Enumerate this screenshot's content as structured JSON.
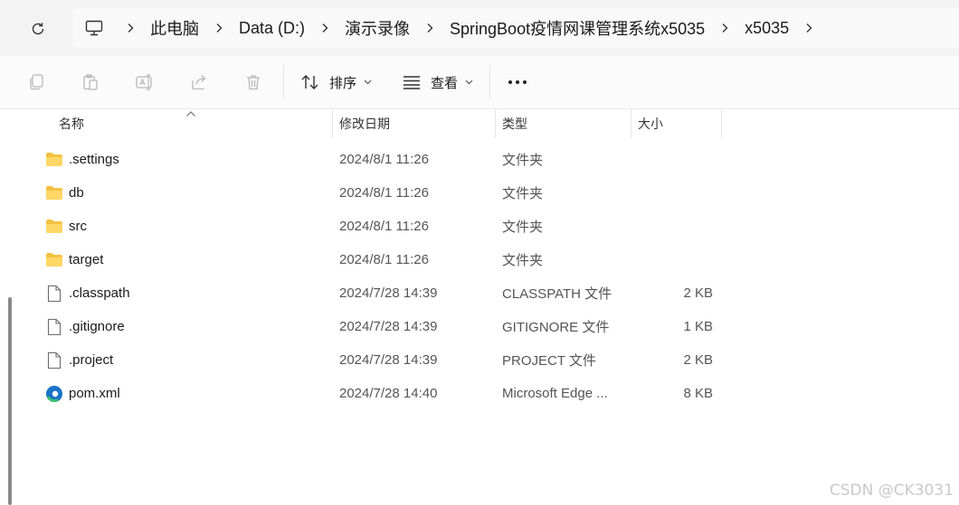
{
  "address": {
    "crumbs": [
      "此电脑",
      "Data (D:)",
      "演示录像",
      "SpringBoot疫情网课管理系统x5035",
      "x5035"
    ]
  },
  "toolbar": {
    "sort_label": "排序",
    "view_label": "查看"
  },
  "columns": {
    "name": "名称",
    "modified": "修改日期",
    "type": "类型",
    "size": "大小"
  },
  "files": [
    {
      "name": ".settings",
      "modified": "2024/8/1 11:26",
      "type": "文件夹",
      "size": "",
      "icon": "folder-icon"
    },
    {
      "name": "db",
      "modified": "2024/8/1 11:26",
      "type": "文件夹",
      "size": "",
      "icon": "folder-icon"
    },
    {
      "name": "src",
      "modified": "2024/8/1 11:26",
      "type": "文件夹",
      "size": "",
      "icon": "folder-icon"
    },
    {
      "name": "target",
      "modified": "2024/8/1 11:26",
      "type": "文件夹",
      "size": "",
      "icon": "folder-icon"
    },
    {
      "name": ".classpath",
      "modified": "2024/7/28 14:39",
      "type": "CLASSPATH 文件",
      "size": "2 KB",
      "icon": "file-icon"
    },
    {
      "name": ".gitignore",
      "modified": "2024/7/28 14:39",
      "type": "GITIGNORE 文件",
      "size": "1 KB",
      "icon": "file-icon"
    },
    {
      "name": ".project",
      "modified": "2024/7/28 14:39",
      "type": "PROJECT 文件",
      "size": "2 KB",
      "icon": "file-icon"
    },
    {
      "name": "pom.xml",
      "modified": "2024/7/28 14:40",
      "type": "Microsoft Edge ...",
      "size": "8 KB",
      "icon": "edge-icon"
    }
  ],
  "watermark": "CSDN @CK3031",
  "colors": {
    "folder": "#f5c242",
    "edge_blue": "#1a73c8",
    "edge_green": "#3bbf6a"
  }
}
